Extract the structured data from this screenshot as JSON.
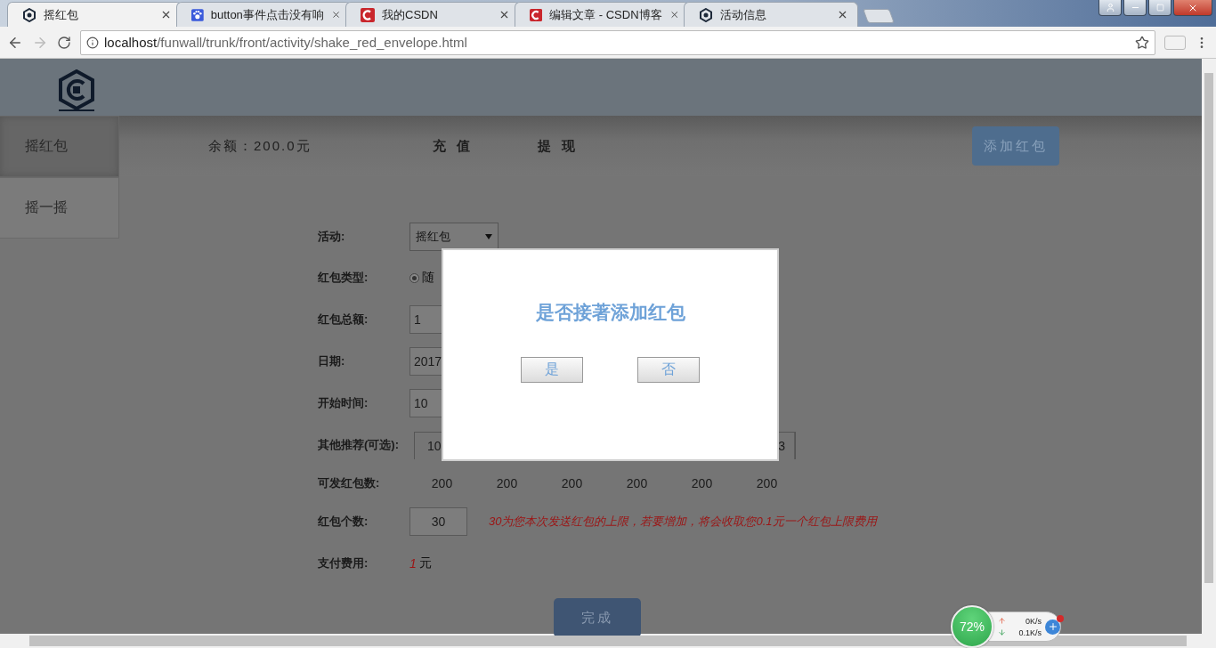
{
  "browser": {
    "tabs": [
      {
        "title": "摇红包",
        "kind": "logo",
        "selected": true
      },
      {
        "title": "button事件点击没有响",
        "kind": "paw",
        "selected": false
      },
      {
        "title": "我的CSDN",
        "kind": "csdn",
        "selected": false
      },
      {
        "title": "编辑文章 - CSDN博客",
        "kind": "csdn",
        "selected": false
      },
      {
        "title": "活动信息",
        "kind": "logo",
        "selected": false
      }
    ],
    "url": {
      "host": "localhost",
      "path": "/funwall/trunk/front/activity/shake_red_envelope.html"
    }
  },
  "sidebar": {
    "items": [
      {
        "label": "摇红包",
        "selected": true
      },
      {
        "label": "摇一摇",
        "selected": false
      }
    ]
  },
  "toolbar": {
    "balance": "余额：200.0元",
    "links": [
      "充 值",
      "提 现"
    ],
    "add_button": "添加红包"
  },
  "form": {
    "rows": [
      {
        "kind": "select",
        "label": "活动:",
        "value": "摇红包"
      },
      {
        "kind": "radio",
        "label": "红包类型:",
        "option": "随",
        "checked": true
      },
      {
        "kind": "input",
        "label": "红包总额:",
        "value": "1"
      },
      {
        "kind": "input",
        "label": "日期:",
        "value": "2017"
      },
      {
        "kind": "input",
        "label": "开始时间:",
        "value": "10"
      },
      {
        "kind": "recommend",
        "label": "其他推荐(可选):",
        "first": "10",
        "last": "3"
      },
      {
        "kind": "counts",
        "label": "可发红包数:",
        "values": [
          "200",
          "200",
          "200",
          "200",
          "200",
          "200"
        ]
      },
      {
        "kind": "note",
        "label": "红包个数:",
        "value": "30",
        "note": "30为您本次发送红包的上限，若要增加，将会收取您0.1元一个红包上限费用"
      },
      {
        "kind": "fee",
        "label": "支付费用:",
        "amount": "1",
        "unit": "元"
      }
    ],
    "submit": "完成"
  },
  "dialog": {
    "title": "是否接著添加红包",
    "buttons": [
      "是",
      "否"
    ]
  },
  "widget": {
    "percent": "72%",
    "upload": "0K/s",
    "download": "0.1K/s"
  }
}
